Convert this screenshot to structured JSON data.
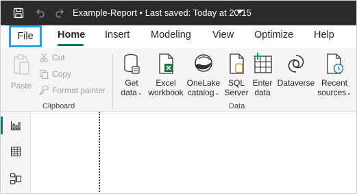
{
  "titlebar": {
    "title": "Example-Report • Last saved: Today at 20:15",
    "icons": [
      "save-icon",
      "undo-icon",
      "redo-icon",
      "chevron-down-icon"
    ]
  },
  "tabs": [
    {
      "label": "File"
    },
    {
      "label": "Home",
      "active": true
    },
    {
      "label": "Insert"
    },
    {
      "label": "Modeling"
    },
    {
      "label": "View"
    },
    {
      "label": "Optimize"
    },
    {
      "label": "Help"
    }
  ],
  "ribbon": {
    "clipboard": {
      "paste": "Paste",
      "cut": "Cut",
      "copy": "Copy",
      "format_painter": "Format painter",
      "group_label": "Clipboard"
    },
    "data": {
      "get_data": [
        "Get",
        "data"
      ],
      "excel": [
        "Excel",
        "workbook"
      ],
      "onelake": [
        "OneLake",
        "catalog"
      ],
      "sql": [
        "SQL",
        "Server"
      ],
      "enter": [
        "Enter",
        "data"
      ],
      "dataverse": "Dataverse",
      "recent": [
        "Recent",
        "sources"
      ],
      "group_label": "Data"
    }
  },
  "rail": {
    "icons": [
      "report-view-icon",
      "table-view-icon",
      "model-view-icon"
    ],
    "active": "report-view-icon"
  },
  "colors": {
    "titlebar_bg": "#2b2b2b",
    "accent": "#117865",
    "file_highlight": "#2ea0e6",
    "excel_green": "#1d7044"
  }
}
